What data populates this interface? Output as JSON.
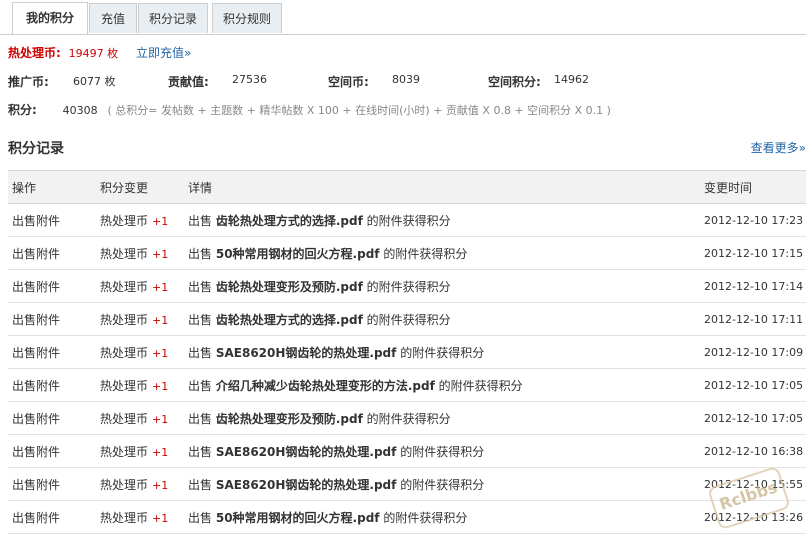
{
  "tabs": [
    "我的积分",
    "充值",
    "积分记录",
    "积分规则"
  ],
  "coin": {
    "label": "热处理币:",
    "value": "19497 枚",
    "recharge": "立即充值»"
  },
  "stats": [
    {
      "label": "推广币:",
      "value": "6077 枚"
    },
    {
      "label": "贡献值:",
      "value": "27536"
    },
    {
      "label": "空间币:",
      "value": "8039"
    },
    {
      "label": "空间积分:",
      "value": "14962"
    }
  ],
  "score": {
    "label": "积分:",
    "value": "40308",
    "formula": "( 总积分= 发帖数 + 主题数 + 精华帖数 X 100 + 在线时间(小时) + 贡献值 X 0.8 + 空间积分 X 0.1 )"
  },
  "records": {
    "title": "积分记录",
    "more": "查看更多»",
    "headers": [
      "操作",
      "积分变更",
      "详情",
      "变更时间"
    ],
    "rows": [
      {
        "op": "出售附件",
        "coin": "热处理币",
        "delta": "+1",
        "pre": "出售",
        "file": "齿轮热处理方式的选择.pdf",
        "post": "的附件获得积分",
        "time": "2012-12-10 17:23"
      },
      {
        "op": "出售附件",
        "coin": "热处理币",
        "delta": "+1",
        "pre": "出售",
        "file": "50种常用钢材的回火方程.pdf",
        "post": "的附件获得积分",
        "time": "2012-12-10 17:15"
      },
      {
        "op": "出售附件",
        "coin": "热处理币",
        "delta": "+1",
        "pre": "出售",
        "file": "齿轮热处理变形及预防.pdf",
        "post": "的附件获得积分",
        "time": "2012-12-10 17:14"
      },
      {
        "op": "出售附件",
        "coin": "热处理币",
        "delta": "+1",
        "pre": "出售",
        "file": "齿轮热处理方式的选择.pdf",
        "post": "的附件获得积分",
        "time": "2012-12-10 17:11"
      },
      {
        "op": "出售附件",
        "coin": "热处理币",
        "delta": "+1",
        "pre": "出售",
        "file": "SAE8620H钢齿轮的热处理.pdf",
        "post": "的附件获得积分",
        "time": "2012-12-10 17:09"
      },
      {
        "op": "出售附件",
        "coin": "热处理币",
        "delta": "+1",
        "pre": "出售",
        "file": "介绍几种减少齿轮热处理变形的方法.pdf",
        "post": "的附件获得积分",
        "time": "2012-12-10 17:05"
      },
      {
        "op": "出售附件",
        "coin": "热处理币",
        "delta": "+1",
        "pre": "出售",
        "file": "齿轮热处理变形及预防.pdf",
        "post": "的附件获得积分",
        "time": "2012-12-10 17:05"
      },
      {
        "op": "出售附件",
        "coin": "热处理币",
        "delta": "+1",
        "pre": "出售",
        "file": "SAE8620H钢齿轮的热处理.pdf",
        "post": "的附件获得积分",
        "time": "2012-12-10 16:38"
      },
      {
        "op": "出售附件",
        "coin": "热处理币",
        "delta": "+1",
        "pre": "出售",
        "file": "SAE8620H钢齿轮的热处理.pdf",
        "post": "的附件获得积分",
        "time": "2012-12-10 15:55"
      },
      {
        "op": "出售附件",
        "coin": "热处理币",
        "delta": "+1",
        "pre": "出售",
        "file": "50种常用钢材的回火方程.pdf",
        "post": "的附件获得积分",
        "time": "2012-12-10 13:26"
      }
    ]
  },
  "watermark": "Rclbbs"
}
